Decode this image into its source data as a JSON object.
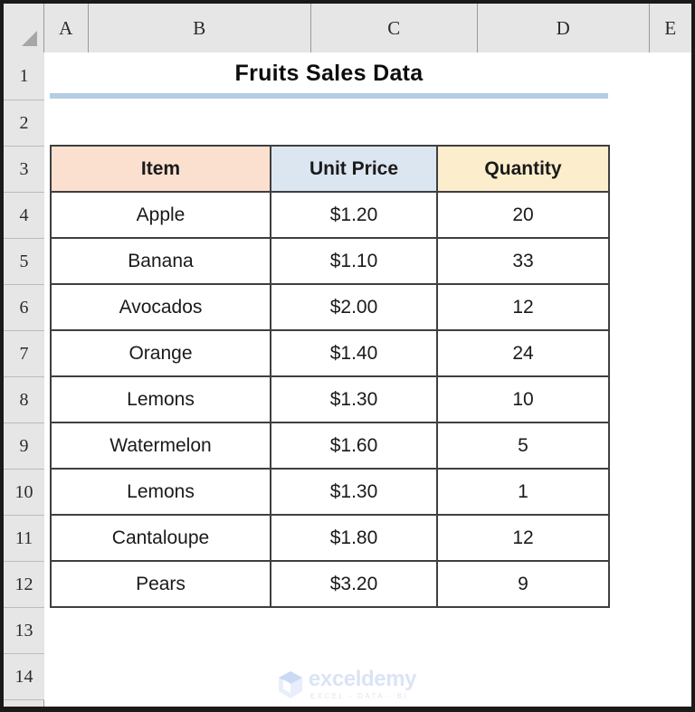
{
  "spreadsheet": {
    "column_headers": [
      "A",
      "B",
      "C",
      "D",
      "E"
    ],
    "row_headers": [
      "1",
      "2",
      "3",
      "4",
      "5",
      "6",
      "7",
      "8",
      "9",
      "10",
      "11",
      "12",
      "13",
      "14"
    ],
    "select_all_icon": "select-all-triangle-icon"
  },
  "title": {
    "text": "Fruits Sales Data",
    "rule_color": "#b4cce4"
  },
  "table": {
    "headers": [
      "Item",
      "Unit Price",
      "Quantity"
    ],
    "header_colors": [
      "#fbe0d0",
      "#dce6f1",
      "#fceecd"
    ],
    "rows": [
      {
        "item": "Apple",
        "unit_price": "$1.20",
        "quantity": "20"
      },
      {
        "item": "Banana",
        "unit_price": "$1.10",
        "quantity": "33"
      },
      {
        "item": "Avocados",
        "unit_price": "$2.00",
        "quantity": "12"
      },
      {
        "item": "Orange",
        "unit_price": "$1.40",
        "quantity": "24"
      },
      {
        "item": "Lemons",
        "unit_price": "$1.30",
        "quantity": "10"
      },
      {
        "item": "Watermelon",
        "unit_price": "$1.60",
        "quantity": "5"
      },
      {
        "item": "Lemons",
        "unit_price": "$1.30",
        "quantity": "1"
      },
      {
        "item": "Cantaloupe",
        "unit_price": "$1.80",
        "quantity": "12"
      },
      {
        "item": "Pears",
        "unit_price": "$3.20",
        "quantity": "9"
      }
    ]
  },
  "watermark": {
    "name": "exceldemy",
    "tagline": "EXCEL - DATA - BI",
    "icon": "exceldemy-cube-logo-icon",
    "color": "#dbe4f5"
  }
}
